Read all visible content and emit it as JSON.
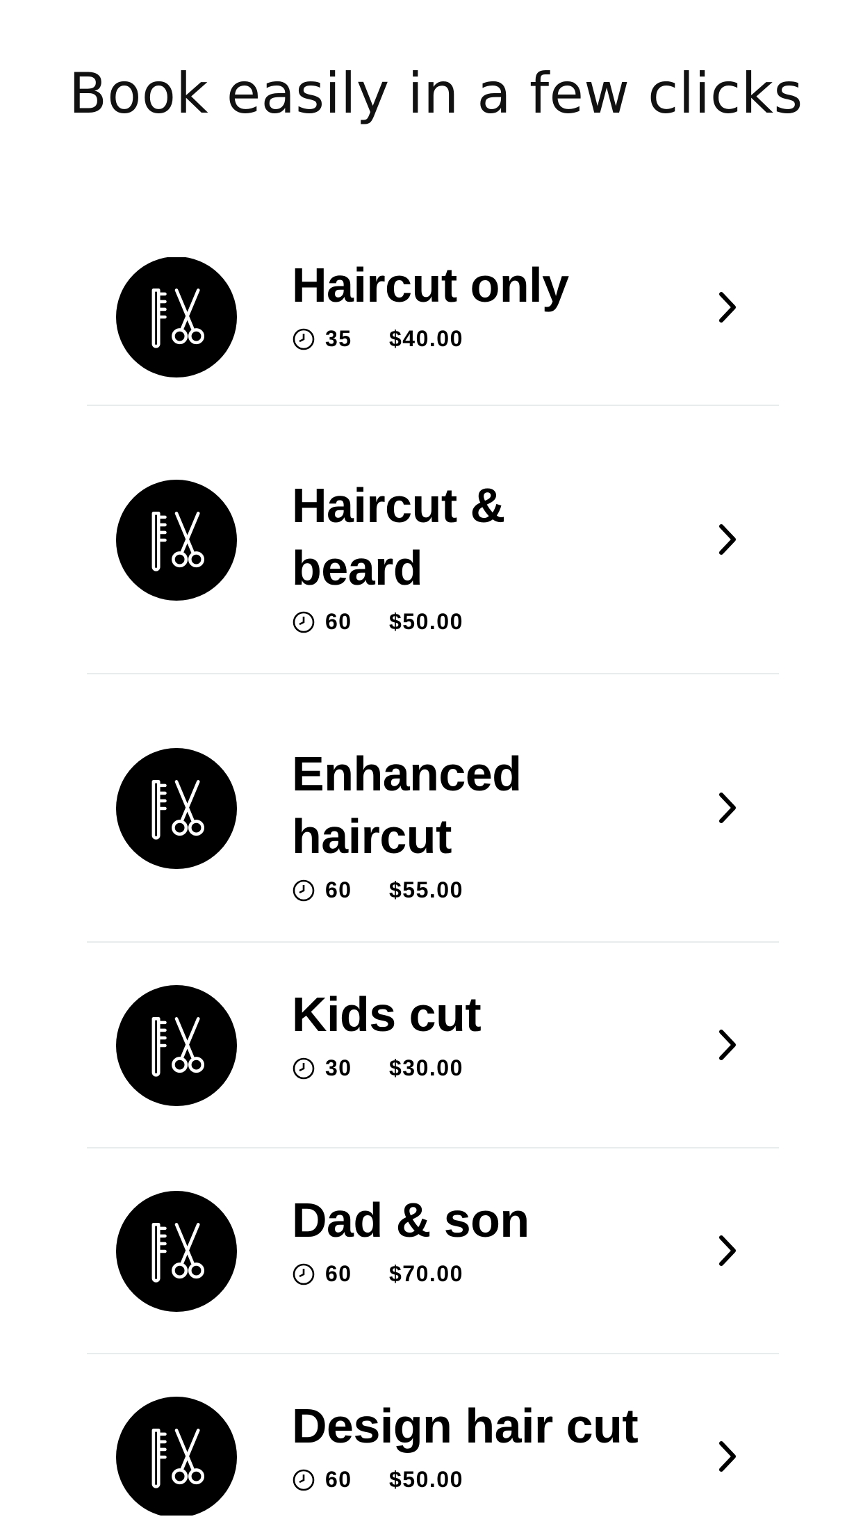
{
  "header": {
    "title": "Book easily in a few clicks"
  },
  "services": [
    {
      "name": "Haircut only",
      "duration": "35",
      "price": "$40.00"
    },
    {
      "name": "Haircut & beard",
      "duration": "60",
      "price": "$50.00"
    },
    {
      "name": "Enhanced haircut",
      "duration": "60",
      "price": "$55.00"
    },
    {
      "name": "Kids cut",
      "duration": "30",
      "price": "$30.00"
    },
    {
      "name": "Dad & son",
      "duration": "60",
      "price": "$70.00"
    },
    {
      "name": "Design hair cut",
      "duration": "60",
      "price": "$50.00"
    }
  ],
  "icons": {
    "service": "comb-scissors-icon",
    "duration": "clock-icon",
    "open": "chevron-right-icon"
  },
  "colors": {
    "background": "#ffffff",
    "text": "#000000",
    "divider": "#e7ecec"
  }
}
